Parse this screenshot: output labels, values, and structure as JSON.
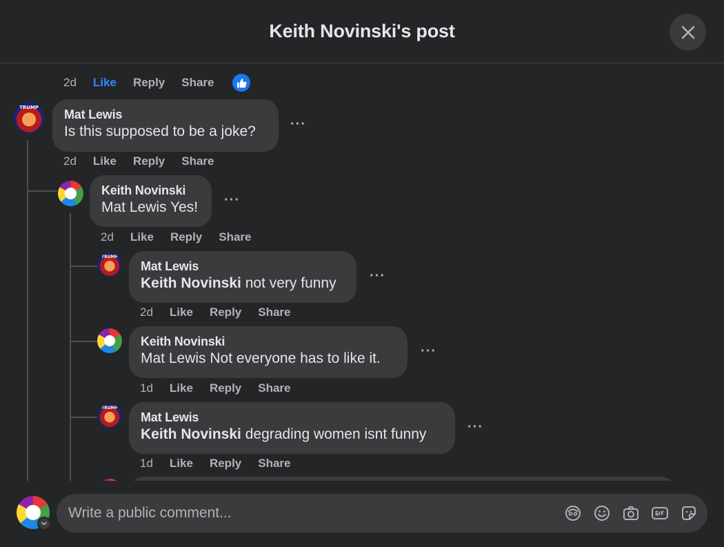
{
  "header": {
    "title": "Keith Novinski's post"
  },
  "comments": [
    {
      "actions": {
        "time": "2d",
        "like": "Like",
        "reply": "Reply",
        "share": "Share"
      }
    },
    {
      "author": "Mat Lewis",
      "text": "Is this supposed to be a joke?",
      "actions": {
        "time": "2d",
        "like": "Like",
        "reply": "Reply",
        "share": "Share"
      }
    },
    {
      "author": "Keith Novinski",
      "mention": "",
      "text": "Mat Lewis Yes!",
      "actions": {
        "time": "2d",
        "like": "Like",
        "reply": "Reply",
        "share": "Share"
      }
    },
    {
      "author": "Mat Lewis",
      "mention": "Keith Novinski",
      "text": " not very funny",
      "actions": {
        "time": "2d",
        "like": "Like",
        "reply": "Reply",
        "share": "Share"
      }
    },
    {
      "author": "Keith Novinski",
      "text": "Mat Lewis Not everyone has to like it.",
      "actions": {
        "time": "1d",
        "like": "Like",
        "reply": "Reply",
        "share": "Share"
      }
    },
    {
      "author": "Mat Lewis",
      "mention": "Keith Novinski",
      "text": " degrading women isnt funny",
      "actions": {
        "time": "1d",
        "like": "Like",
        "reply": "Reply",
        "share": "Share"
      }
    }
  ],
  "avatar_badge_text": "TRUMP",
  "more_label": "···",
  "composer": {
    "placeholder": "Write a public comment..."
  },
  "colors": {
    "background": "#242526",
    "bubble": "#3a3b3c",
    "accent": "#2d88ff",
    "muted": "#b0b3b8"
  },
  "icons": [
    "close-icon",
    "like-reaction-icon",
    "avatar-icon",
    "emoji-icon",
    "camera-icon",
    "gif-icon",
    "sticker-icon"
  ]
}
